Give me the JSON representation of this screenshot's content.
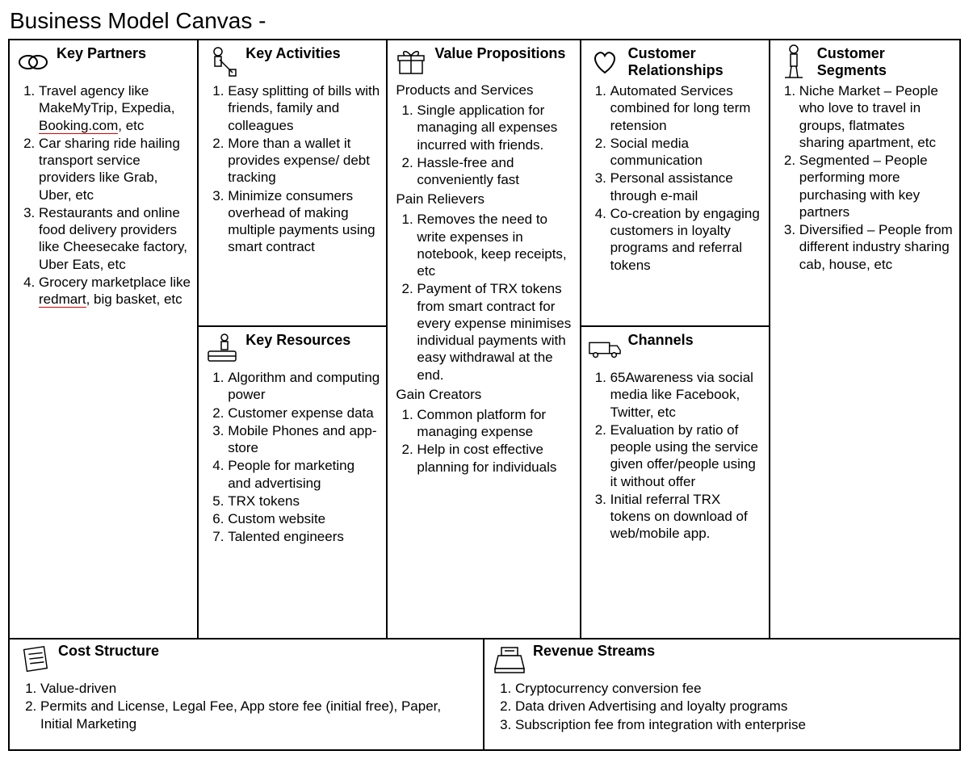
{
  "title": "Business Model Canvas -",
  "partners": {
    "heading": "Key Partners",
    "items": [
      "Travel agency like MakeMyTrip, Expedia, Booking.com, etc",
      "Car sharing ride hailing transport service providers like Grab, Uber, etc",
      "Restaurants and online food delivery providers like Cheesecake factory, Uber Eats, etc",
      "Grocery marketplace like redmart, big basket, etc"
    ]
  },
  "activities": {
    "heading": "Key Activities",
    "items": [
      "Easy splitting of bills with friends, family and colleagues",
      "More than a wallet it provides expense/ debt tracking",
      "Minimize consumers overhead of making multiple payments using smart contract"
    ]
  },
  "resources": {
    "heading": "Key Resources",
    "items": [
      "Algorithm and computing power",
      "Customer expense data",
      "Mobile Phones and app-store",
      "People for marketing and advertising",
      "TRX tokens",
      "Custom website",
      "Talented engineers"
    ]
  },
  "value": {
    "heading": "Value Propositions",
    "sub1": "Products and Services",
    "list1": [
      "Single application for managing all expenses incurred with friends.",
      "Hassle-free and conveniently fast"
    ],
    "sub2": "Pain Relievers",
    "list2": [
      "Removes the need to write expenses in notebook, keep receipts, etc",
      "Payment of TRX tokens from smart contract for every expense minimises individual payments with easy withdrawal at the end."
    ],
    "sub3": "Gain Creators",
    "list3": [
      "Common platform for managing expense",
      "Help in cost effective planning for individuals"
    ]
  },
  "relationships": {
    "heading": "Customer Relationships",
    "items": [
      "Automated Services combined for long term retension",
      "Social media communication",
      "Personal assistance through e-mail",
      "Co-creation by engaging customers in loyalty programs and referral tokens"
    ]
  },
  "channels": {
    "heading": "Channels",
    "items": [
      "65Awareness via social media like Facebook, Twitter, etc",
      "Evaluation by ratio of people using the service given offer/people using it without offer",
      "Initial referral TRX tokens on download of web/mobile app."
    ]
  },
  "segments": {
    "heading": "Customer Segments",
    "items": [
      "Niche Market – People who love to travel in groups, flatmates sharing apartment, etc",
      "Segmented – People performing more purchasing with key partners",
      "Diversified – People from different industry sharing cab, house, etc"
    ]
  },
  "cost": {
    "heading": "Cost Structure",
    "items": [
      "Value-driven",
      "Permits and License, Legal Fee, App store fee (initial free), Paper, Initial Marketing"
    ]
  },
  "revenue": {
    "heading": "Revenue Streams",
    "items": [
      "Cryptocurrency conversion fee",
      "Data driven Advertising and loyalty programs",
      "Subscription fee from integration with enterprise"
    ]
  }
}
